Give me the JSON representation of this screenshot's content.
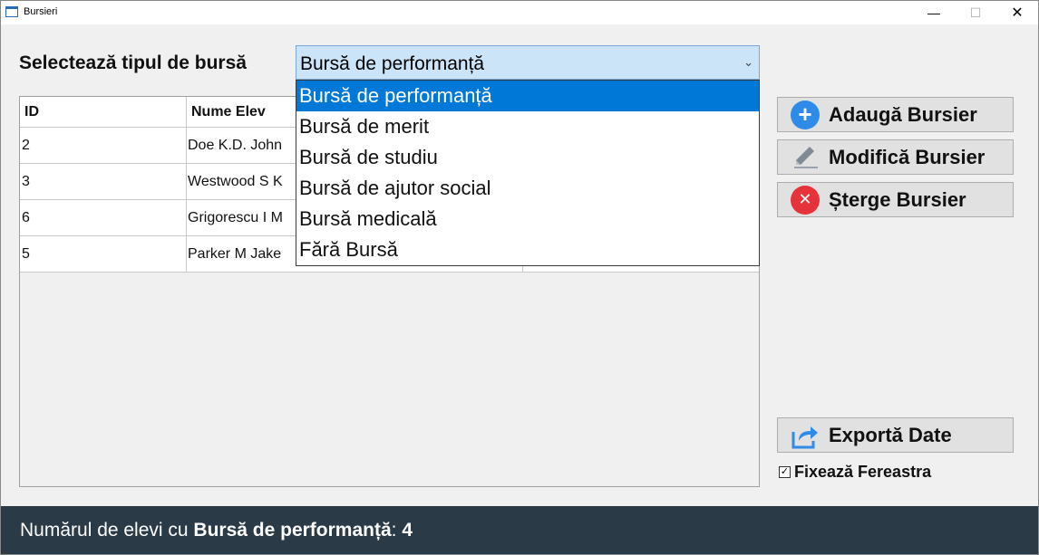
{
  "window": {
    "title": "Bursieri",
    "min_glyph": "—",
    "max_glyph": "☐",
    "close_glyph": "✕"
  },
  "filter": {
    "label": "Selectează tipul de bursă",
    "selected": "Bursă de performanță",
    "options": [
      "Bursă de performanță",
      "Bursă de merit",
      "Bursă de studiu",
      "Bursă de ajutor social",
      "Bursă medicală",
      "Fără Bursă"
    ]
  },
  "table": {
    "columns": [
      "ID",
      "Nume Elev"
    ],
    "rows": [
      {
        "id": "2",
        "name": "Doe K.D. John"
      },
      {
        "id": "3",
        "name": "Westwood S K"
      },
      {
        "id": "6",
        "name": "Grigorescu I M"
      },
      {
        "id": "5",
        "name": "Parker M Jake"
      }
    ]
  },
  "actions": {
    "add": "Adaugă Bursier",
    "edit": "Modifică Bursier",
    "delete": "Șterge Bursier",
    "export": "Exportă Date"
  },
  "pin_window": {
    "label": "Fixează Fereastra",
    "checked": true
  },
  "status": {
    "prefix": "Numărul de elevi cu ",
    "type": "Bursă de performanță",
    "sep": ": ",
    "count": "4"
  },
  "colors": {
    "accent": "#0078d7",
    "statusbar": "#2b3a47",
    "add_icon": "#2f8be8",
    "delete_icon": "#e5323b"
  }
}
